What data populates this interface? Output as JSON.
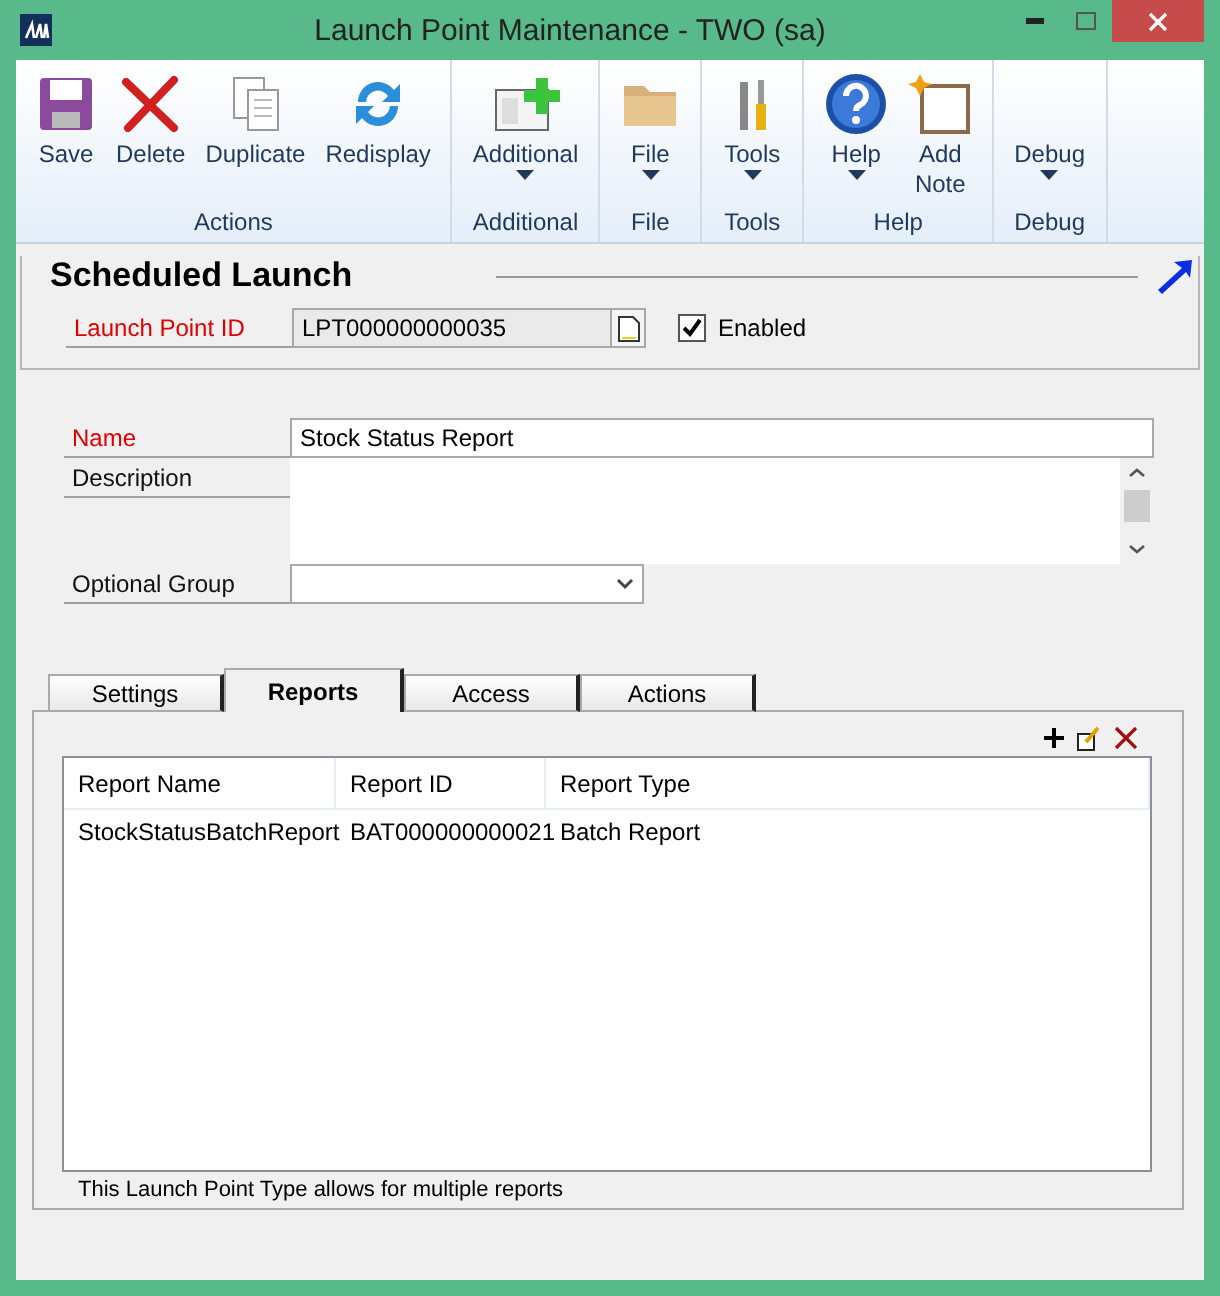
{
  "window": {
    "title": "Launch Point Maintenance  -  TWO (sa)"
  },
  "ribbon": {
    "groups": [
      {
        "label": "Actions",
        "buttons": [
          {
            "label": "Save",
            "dropdown": false
          },
          {
            "label": "Delete",
            "dropdown": false
          },
          {
            "label": "Duplicate",
            "dropdown": false
          },
          {
            "label": "Redisplay",
            "dropdown": false
          }
        ]
      },
      {
        "label": "Additional",
        "buttons": [
          {
            "label": "Additional",
            "dropdown": true
          }
        ]
      },
      {
        "label": "File",
        "buttons": [
          {
            "label": "File",
            "dropdown": true
          }
        ]
      },
      {
        "label": "Tools",
        "buttons": [
          {
            "label": "Tools",
            "dropdown": true
          }
        ]
      },
      {
        "label": "Help",
        "buttons": [
          {
            "label": "Help",
            "dropdown": true
          },
          {
            "label": "Add Note",
            "dropdown": false
          }
        ]
      },
      {
        "label": "Debug",
        "buttons": [
          {
            "label": "Debug",
            "dropdown": true
          }
        ]
      }
    ]
  },
  "header": {
    "title": "Scheduled Launch",
    "launch_point_id": {
      "label": "Launch Point  ID",
      "value": "LPT000000000035",
      "required": true
    },
    "enabled": {
      "label": "Enabled",
      "checked": true
    }
  },
  "form": {
    "name": {
      "label": "Name",
      "value": "Stock Status Report",
      "required": true
    },
    "description": {
      "label": "Description",
      "required": false
    },
    "optional_group": {
      "label": "Optional Group",
      "required": false
    }
  },
  "tabs": [
    {
      "label": "Settings",
      "selected": false
    },
    {
      "label": "Reports",
      "selected": true
    },
    {
      "label": "Access",
      "selected": false
    },
    {
      "label": "Actions",
      "selected": false
    }
  ],
  "table": {
    "columns": [
      "Report Name",
      "Report ID",
      "Report Type"
    ],
    "rows": [
      [
        "StockStatusBatchReport",
        "BAT000000000021",
        "Batch Report"
      ]
    ]
  },
  "footer_note": "This Launch Point Type allows for multiple reports"
}
